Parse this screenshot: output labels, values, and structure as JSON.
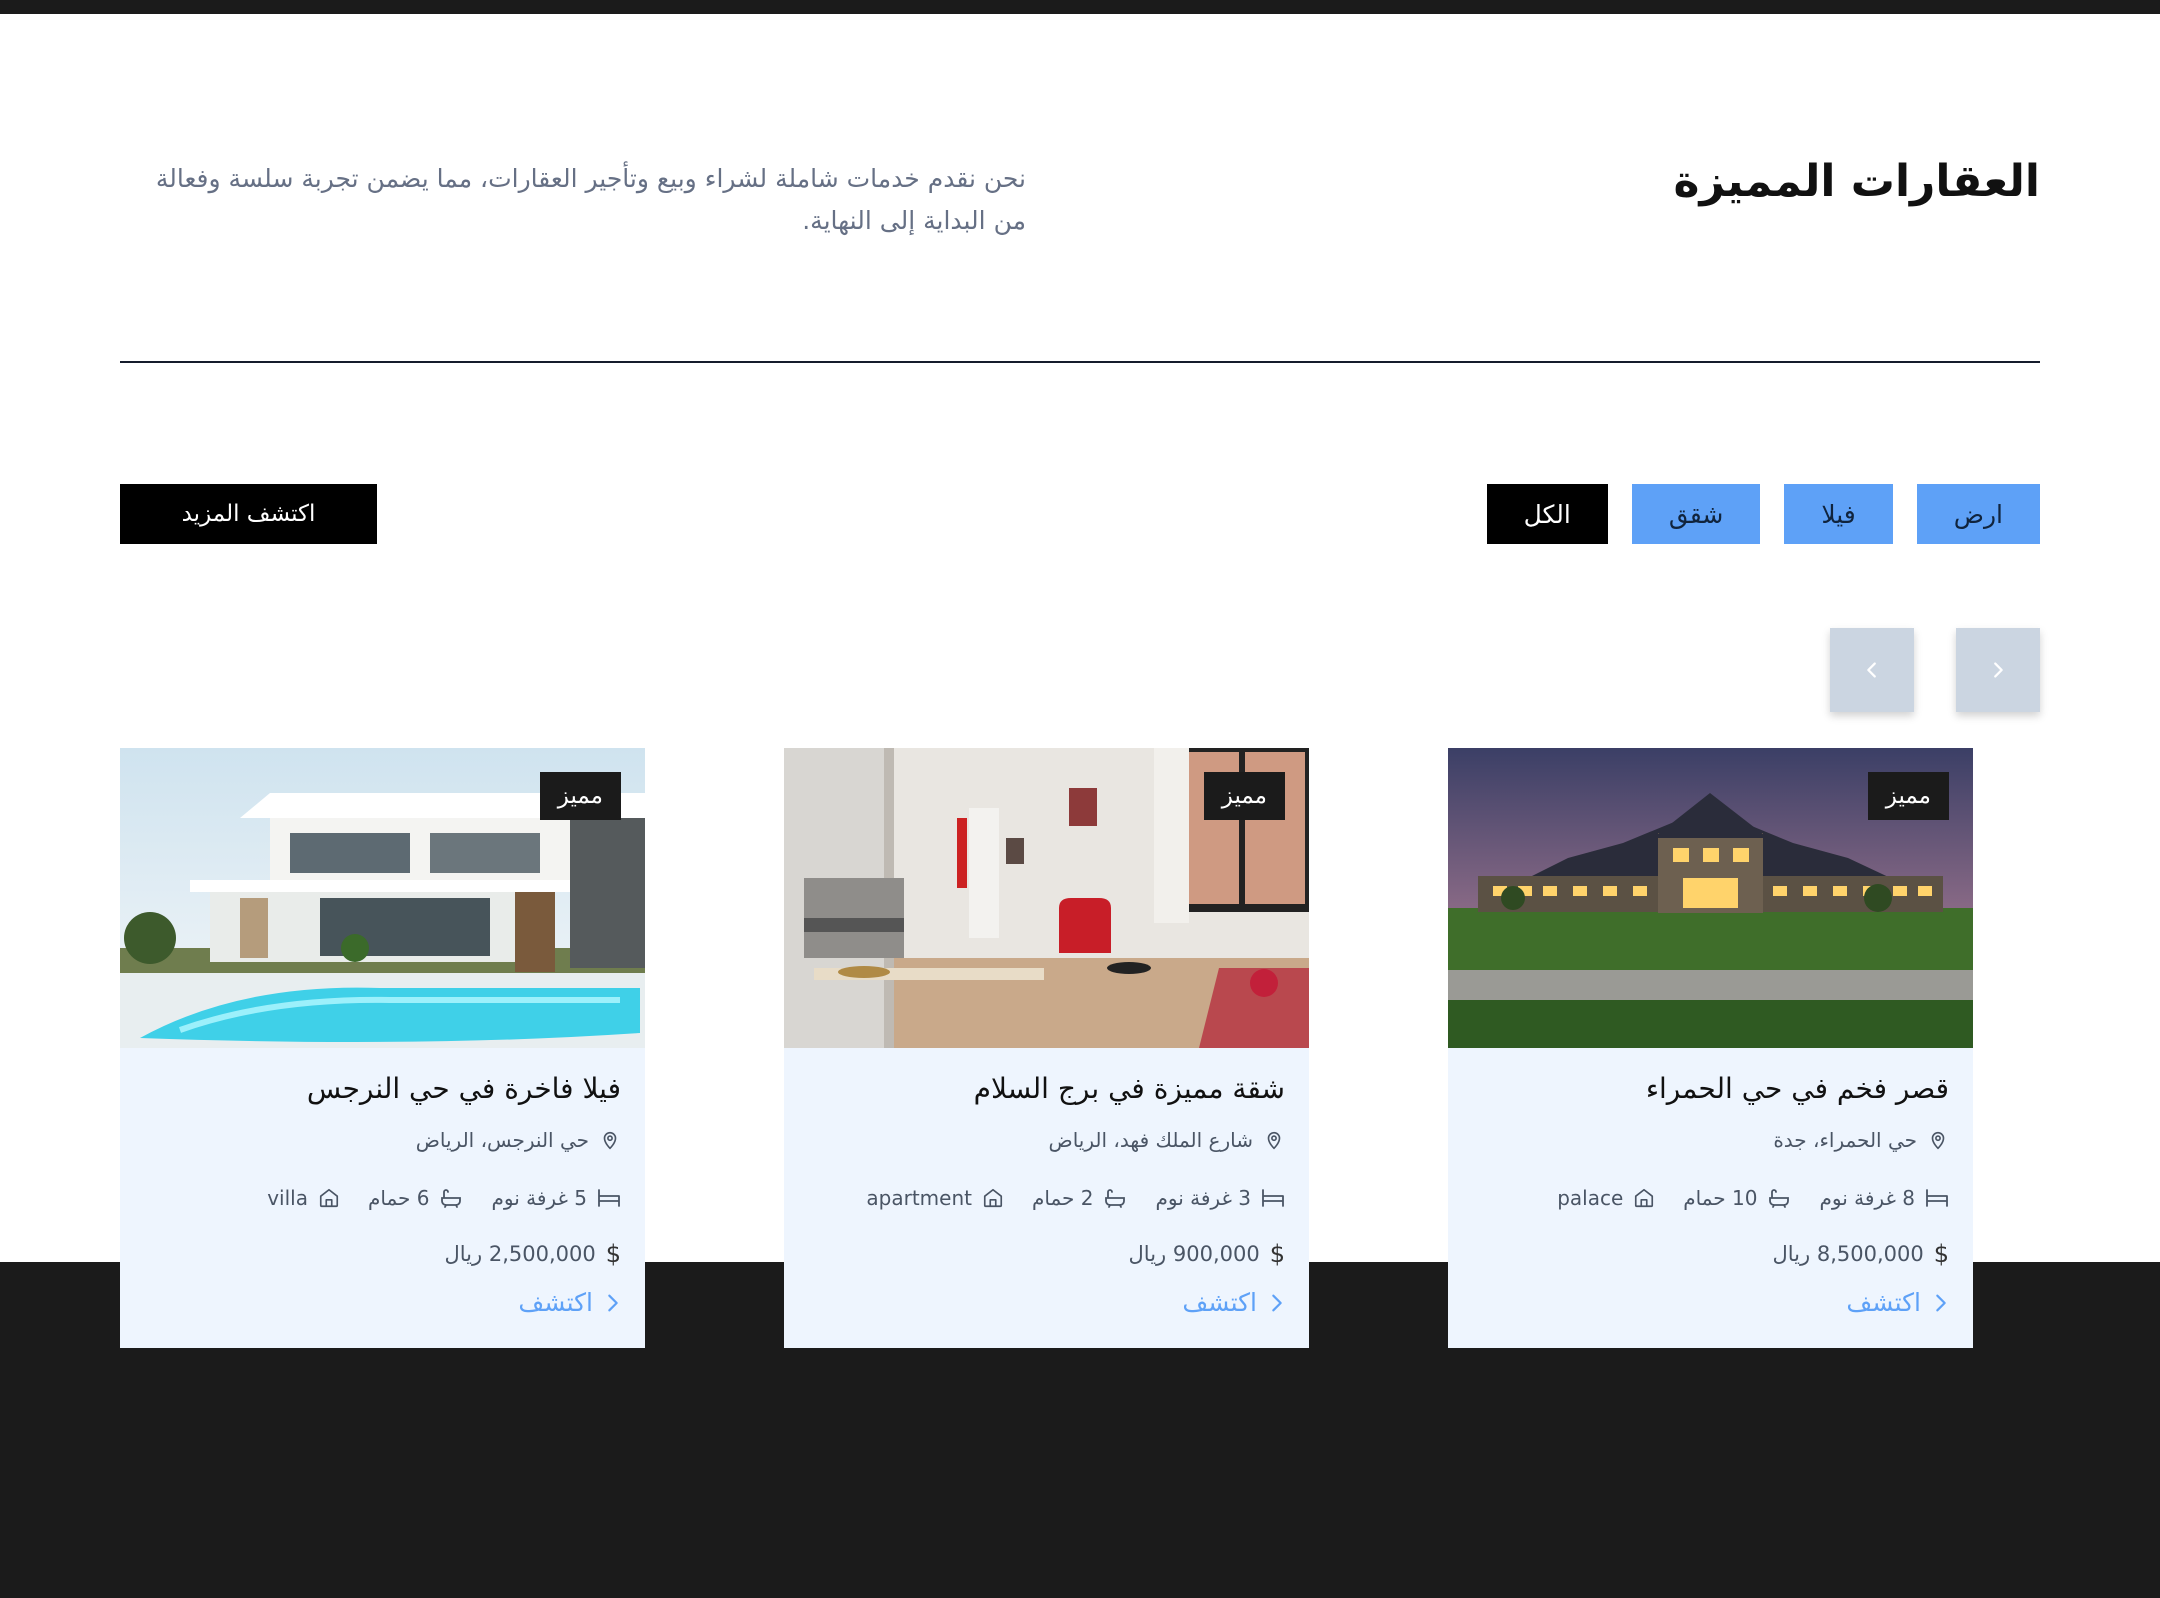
{
  "section": {
    "title": "العقارات المميزة",
    "intro": "نحن نقدم خدمات شاملة لشراء وبيع وتأجير العقارات، مما يضمن تجربة سلسة وفعالة من البداية إلى النهاية."
  },
  "filters": {
    "land": "ارض",
    "villa": "فيلا",
    "apartments": "شقق",
    "all": "الكل"
  },
  "more_label": "اكتشف المزيد",
  "colors": {
    "accent": "#5ea1f7",
    "dark": "#1b1b1b",
    "card": "#eef5fe",
    "arrow": "#cbd5e1"
  },
  "cards": [
    {
      "badge": "مميز",
      "title": "قصر فخم في حي الحمراء",
      "location": "حي الحمراء، جدة",
      "beds": "8 غرفة نوم",
      "baths": "10 حمام",
      "type": "palace",
      "price": "8,500,000 ريال",
      "explore": "اكتشف"
    },
    {
      "badge": "مميز",
      "title": "شقة مميزة في برج السلام",
      "location": "شارع الملك فهد، الرياض",
      "beds": "3 غرفة نوم",
      "baths": "2 حمام",
      "type": "apartment",
      "price": "900,000 ريال",
      "explore": "اكتشف"
    },
    {
      "badge": "مميز",
      "title": "فيلا فاخرة في حي النرجس",
      "location": "حي النرجس، الرياض",
      "beds": "5 غرفة نوم",
      "baths": "6 حمام",
      "type": "villa",
      "price": "2,500,000 ريال",
      "explore": "اكتشف"
    }
  ]
}
